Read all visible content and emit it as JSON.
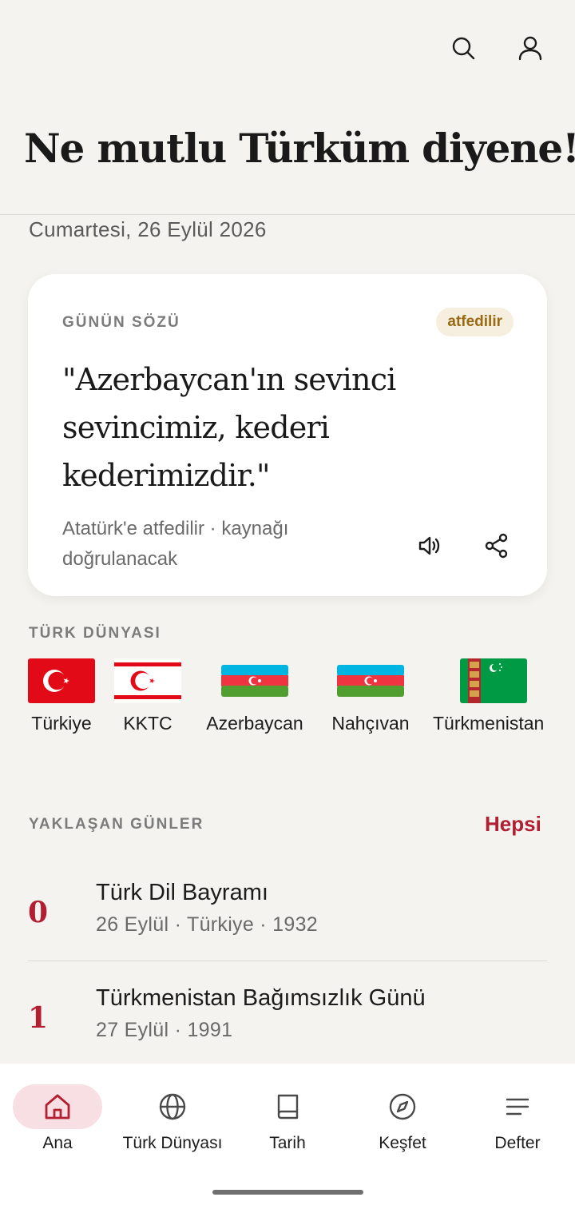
{
  "header": {
    "headline": "Ne mutlu Türküm diyene!",
    "date": "Cumartesi, 26 Eylül 2026"
  },
  "quote_card": {
    "label": "GÜNÜN SÖZÜ",
    "badge": "atfedilir",
    "text": "\"Azerbaycan'ın sevinci sevincimiz, kederi kederimizdir.\"",
    "attribution": "Atatürk'e atfedilir · kaynağı doğrulanacak"
  },
  "turk_dunyasi": {
    "label": "TÜRK DÜNYASI",
    "items": [
      {
        "name": "Türkiye",
        "flag": "turkey-flag"
      },
      {
        "name": "KKTC",
        "flag": "trnc-flag"
      },
      {
        "name": "Azerbaycan",
        "flag": "azerbaijan-flag"
      },
      {
        "name": "Nahçıvan",
        "flag": "nakhchivan-flag"
      },
      {
        "name": "Türkmenistan",
        "flag": "turkmenistan-flag"
      }
    ]
  },
  "upcoming": {
    "label": "YAKLAŞAN GÜNLER",
    "all_link": "Hepsi",
    "events": [
      {
        "num": "0",
        "title": "Türk Dil Bayramı",
        "subtitle": "26 Eylül · Türkiye · 1932"
      },
      {
        "num": "1",
        "title": "Türkmenistan Bağımsızlık Günü",
        "subtitle": "27 Eylül · 1991"
      }
    ]
  },
  "nav": {
    "items": [
      {
        "label": "Ana",
        "icon": "home-icon",
        "active": true
      },
      {
        "label": "Türk Dünyası",
        "icon": "globe-icon"
      },
      {
        "label": "Tarih",
        "icon": "book-icon"
      },
      {
        "label": "Keşfet",
        "icon": "compass-icon"
      },
      {
        "label": "Defter",
        "icon": "notes-icon"
      }
    ]
  },
  "colors": {
    "accent": "#b21f32",
    "background": "#f4f3ef",
    "badge_bg": "#f6eedf",
    "badge_text": "#9a6a12",
    "active_pill": "#f7dfe3"
  }
}
